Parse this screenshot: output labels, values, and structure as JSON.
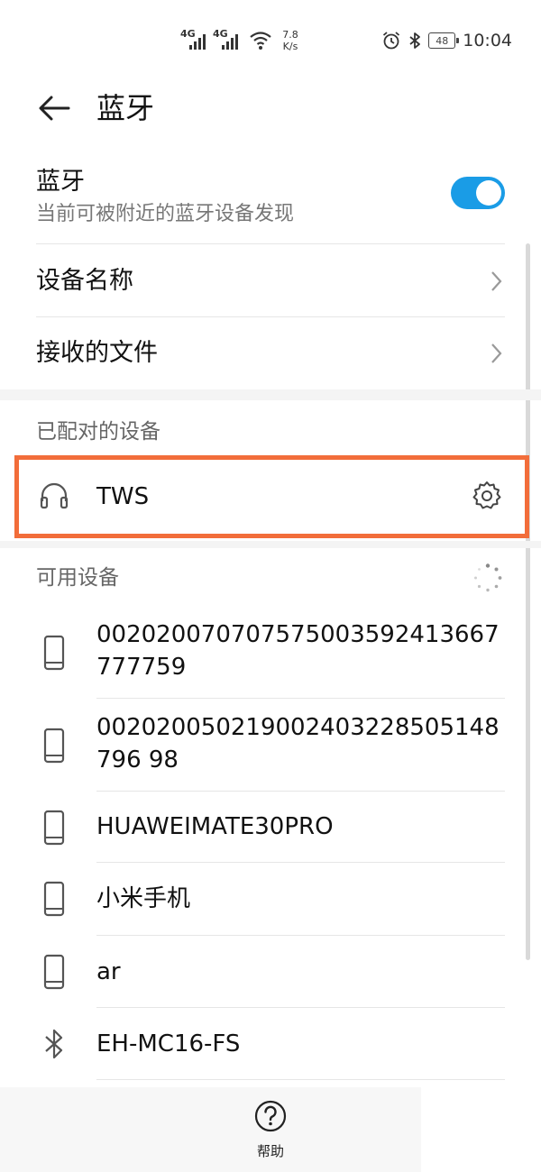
{
  "status_bar": {
    "signal_1_tag": "4G",
    "signal_2_tag": "4G",
    "net_speed_value": "7.8",
    "net_speed_unit": "K/s",
    "battery_level": "48",
    "time": "10:04"
  },
  "header": {
    "title": "蓝牙"
  },
  "bluetooth": {
    "label": "蓝牙",
    "subtitle": "当前可被附近的蓝牙设备发现",
    "enabled": true
  },
  "settings": {
    "device_name_label": "设备名称",
    "received_files_label": "接收的文件"
  },
  "paired": {
    "section_label": "已配对的设备",
    "devices": [
      {
        "name": "TWS",
        "icon": "headset-icon"
      }
    ]
  },
  "available": {
    "section_label": "可用设备",
    "devices": [
      {
        "name": "002020070707575003592413667777759",
        "icon": "phone-icon"
      },
      {
        "name": "002020050219002403228505148796 98",
        "icon": "phone-icon"
      },
      {
        "name": "HUAWEIMATE30PRO",
        "icon": "phone-icon"
      },
      {
        "name": "小米手机",
        "icon": "phone-icon"
      },
      {
        "name": "ar",
        "icon": "phone-icon"
      },
      {
        "name": "EH-MC16-FS",
        "icon": "bluetooth-icon"
      }
    ]
  },
  "bottom_bar": {
    "help_label": "帮助"
  },
  "colors": {
    "accent": "#1a9ce6",
    "highlight": "#f26d3a"
  }
}
